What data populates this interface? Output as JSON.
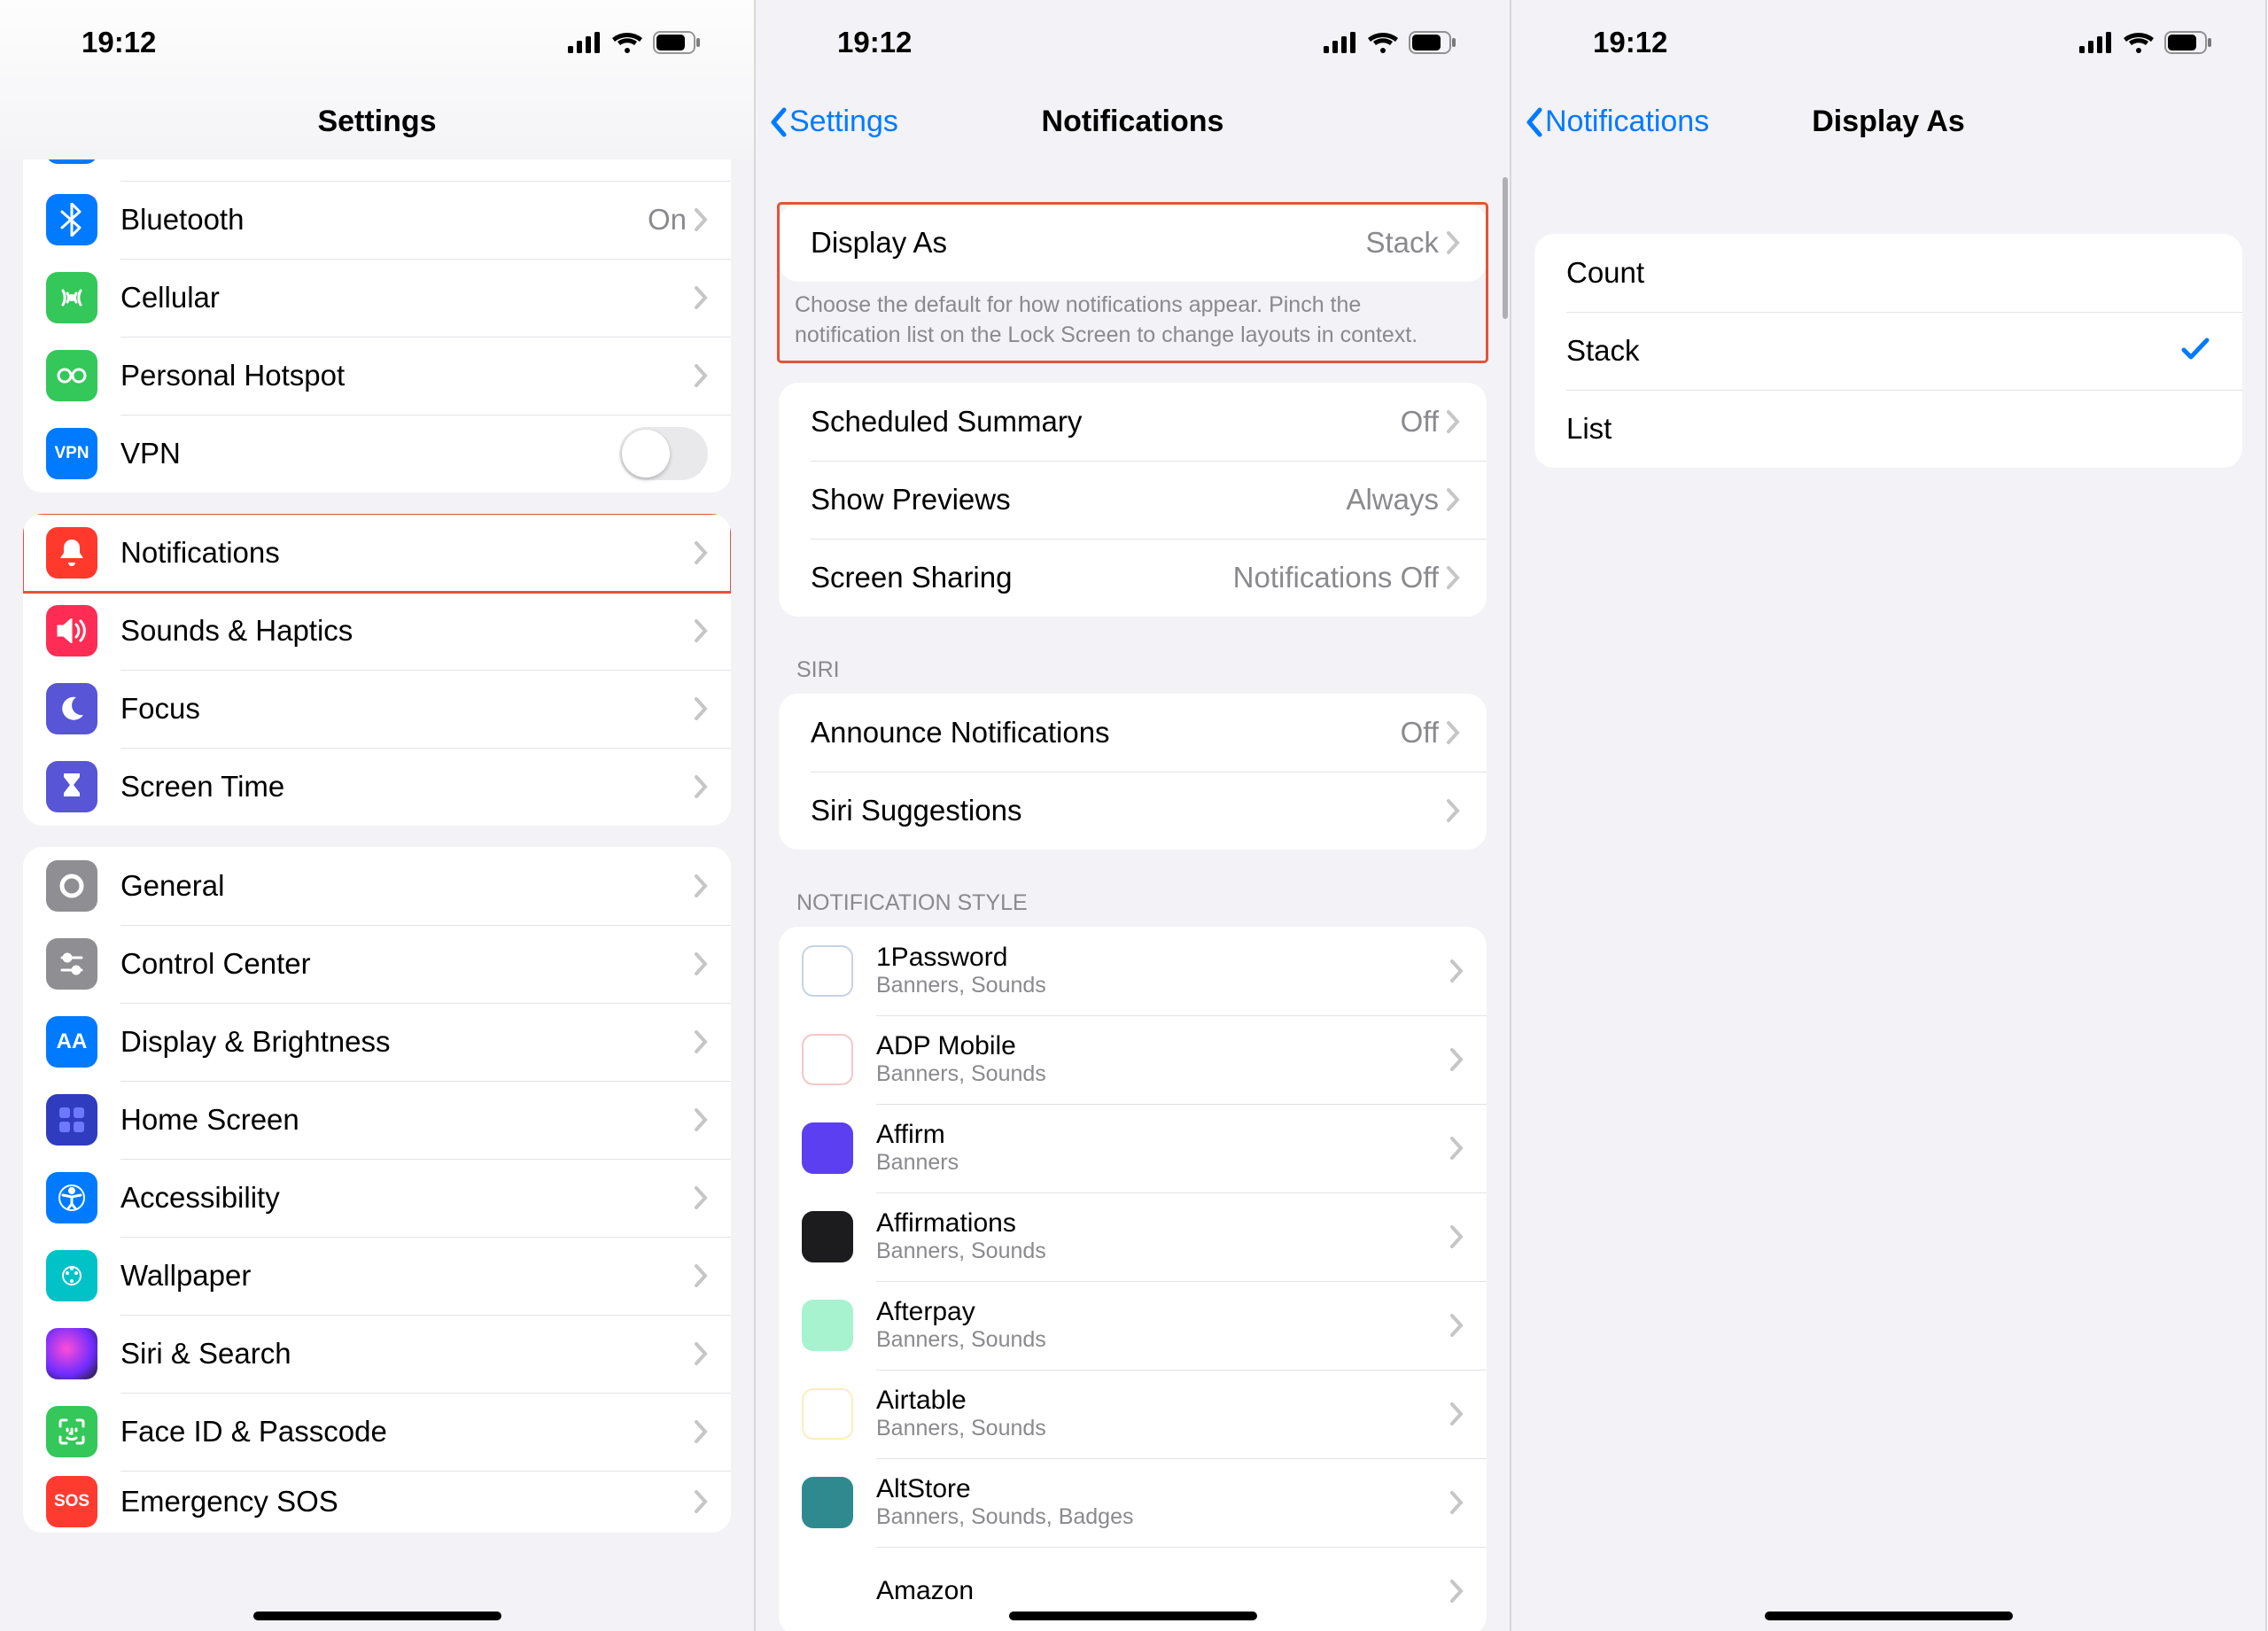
{
  "status": {
    "time": "19:12"
  },
  "phone1": {
    "title": "Settings",
    "rows_group0_partial": [
      {
        "icon": "#007aff",
        "glyph": "airplane",
        "label": ""
      }
    ],
    "rows_group1": [
      {
        "id": "bluetooth",
        "icon": "#007aff",
        "glyph": "✱",
        "label": "Bluetooth",
        "detail": "On"
      },
      {
        "id": "cellular",
        "icon": "#34c759",
        "glyph": "⎍",
        "label": "Cellular",
        "detail": ""
      },
      {
        "id": "hotspot",
        "icon": "#34c759",
        "glyph": "⟳",
        "label": "Personal Hotspot",
        "detail": ""
      },
      {
        "id": "vpn",
        "icon": "#007aff",
        "glyph": "VPN",
        "label": "VPN",
        "switch": true
      }
    ],
    "rows_group2": [
      {
        "id": "notifications",
        "icon": "#ff3a2d",
        "label": "Notifications",
        "highlight": true
      },
      {
        "id": "sounds",
        "icon": "#ff2d55",
        "label": "Sounds & Haptics"
      },
      {
        "id": "focus",
        "icon": "#5856d6",
        "label": "Focus"
      },
      {
        "id": "screentime",
        "icon": "#5856d6",
        "label": "Screen Time"
      }
    ],
    "rows_group3": [
      {
        "id": "general",
        "icon": "#8e8e93",
        "label": "General"
      },
      {
        "id": "controlcenter",
        "icon": "#8e8e93",
        "label": "Control Center"
      },
      {
        "id": "display",
        "icon": "#007aff",
        "glyph": "AA",
        "label": "Display & Brightness"
      },
      {
        "id": "homescreen",
        "icon": "#2f3cc0",
        "label": "Home Screen"
      },
      {
        "id": "accessibility",
        "icon": "#007aff",
        "label": "Accessibility"
      },
      {
        "id": "wallpaper",
        "icon": "#00c2c7",
        "label": "Wallpaper"
      },
      {
        "id": "siri",
        "icon": "#1c1c1e",
        "label": "Siri & Search"
      },
      {
        "id": "faceid",
        "icon": "#34c759",
        "label": "Face ID & Passcode"
      },
      {
        "id": "sos",
        "icon": "#ff3b30",
        "glyph": "SOS",
        "label": "Emergency SOS"
      }
    ]
  },
  "phone2": {
    "back": "Settings",
    "title": "Notifications",
    "display_as": {
      "label": "Display As",
      "value": "Stack"
    },
    "footer": "Choose the default for how notifications appear. Pinch the notification list on the Lock Screen to change layouts in context.",
    "rows_b": [
      {
        "id": "scheduled",
        "label": "Scheduled Summary",
        "detail": "Off"
      },
      {
        "id": "previews",
        "label": "Show Previews",
        "detail": "Always"
      },
      {
        "id": "screensharing",
        "label": "Screen Sharing",
        "detail": "Notifications Off"
      }
    ],
    "siri_header": "SIRI",
    "rows_siri": [
      {
        "id": "announce",
        "label": "Announce Notifications",
        "detail": "Off"
      },
      {
        "id": "siri-suggestions",
        "label": "Siri Suggestions",
        "detail": ""
      }
    ],
    "style_header": "NOTIFICATION STYLE",
    "apps": [
      {
        "name": "1Password",
        "sub": "Banners, Sounds",
        "icon": "#fff",
        "ring": "#1a4f9c"
      },
      {
        "name": "ADP Mobile",
        "sub": "Banners, Sounds",
        "icon": "#fff",
        "ring": "#d32121"
      },
      {
        "name": "Affirm",
        "sub": "Banners",
        "icon": "#5b3ff0",
        "ring": "#5b3ff0"
      },
      {
        "name": "Affirmations",
        "sub": "Banners, Sounds",
        "icon": "#1c1c1e",
        "ring": "#1c1c1e"
      },
      {
        "name": "Afterpay",
        "sub": "Banners, Sounds",
        "icon": "#a7f3cf",
        "ring": "#000"
      },
      {
        "name": "Airtable",
        "sub": "Banners, Sounds",
        "icon": "#fff",
        "ring": "#fcb400"
      },
      {
        "name": "AltStore",
        "sub": "Banners, Sounds, Badges",
        "icon": "#2f8a8f",
        "ring": "#2f8a8f"
      },
      {
        "name": "Amazon",
        "sub": "",
        "icon": "#fff",
        "ring": "#f90"
      }
    ]
  },
  "phone3": {
    "back": "Notifications",
    "title": "Display As",
    "options": [
      {
        "label": "Count",
        "selected": false
      },
      {
        "label": "Stack",
        "selected": true
      },
      {
        "label": "List",
        "selected": false
      }
    ]
  }
}
